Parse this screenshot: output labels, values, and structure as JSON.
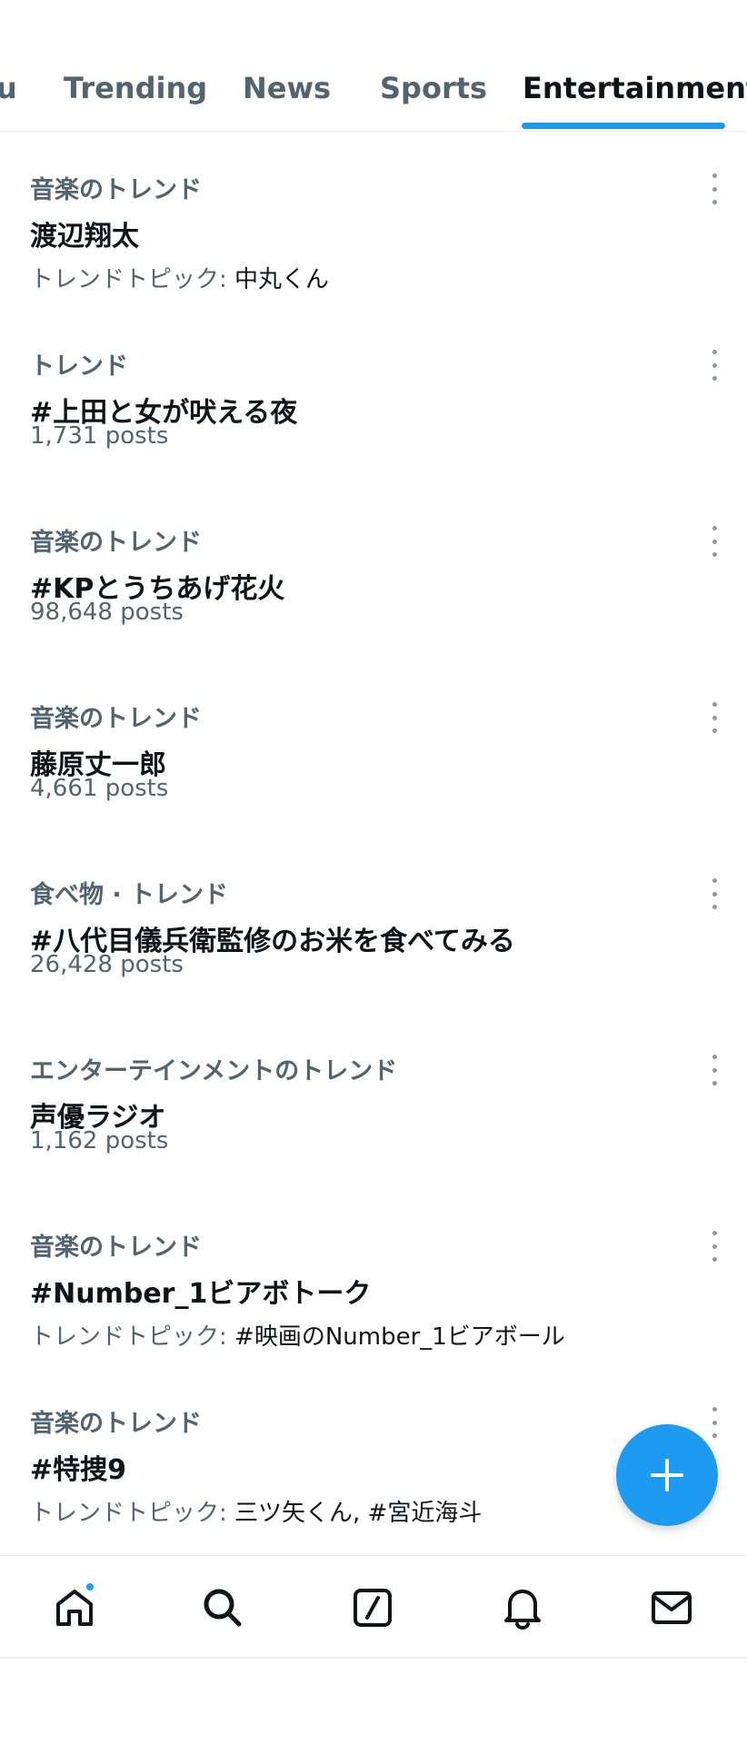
{
  "tabs": [
    {
      "label": "u"
    },
    {
      "label": "Trending"
    },
    {
      "label": "News"
    },
    {
      "label": "Sports"
    },
    {
      "label": "Entertainment",
      "active": true
    }
  ],
  "trends": [
    {
      "category": "音楽のトレンド",
      "title": "渡辺翔太",
      "topic_prefix": "トレンドトピック: ",
      "topic_value": "中丸くん",
      "posts": ""
    },
    {
      "category": "トレンド",
      "title": "#上田と女が吠える夜",
      "topic_prefix": "",
      "topic_value": "",
      "posts": "1,731 posts"
    },
    {
      "category": "音楽のトレンド",
      "title": "#KPとうちあげ花火",
      "topic_prefix": "",
      "topic_value": "",
      "posts": "98,648 posts"
    },
    {
      "category": "音楽のトレンド",
      "title": "藤原丈一郎",
      "topic_prefix": "",
      "topic_value": "",
      "posts": "4,661 posts"
    },
    {
      "category": "食べ物 · トレンド",
      "title": "#八代目儀兵衛監修のお米を食べてみる",
      "topic_prefix": "",
      "topic_value": "",
      "posts": "26,428 posts"
    },
    {
      "category": "エンターテインメントのトレンド",
      "title": "声優ラジオ",
      "topic_prefix": "",
      "topic_value": "",
      "posts": "1,162 posts"
    },
    {
      "category": "音楽のトレンド",
      "title": "#Number_1ビアボトーク",
      "topic_prefix": "トレンドトピック: ",
      "topic_value": "#映画のNumber_1ビアボール",
      "posts": ""
    },
    {
      "category": "音楽のトレンド",
      "title": "#特捜9",
      "topic_prefix": "トレンドトピック: ",
      "topic_value": "三ツ矢くん, #宮近海斗",
      "posts": ""
    }
  ],
  "fab": {
    "icon": "plus-icon"
  },
  "bottom_nav": {
    "items": [
      {
        "icon": "home-icon",
        "has_notification_dot": true
      },
      {
        "icon": "search-icon"
      },
      {
        "icon": "grok-icon"
      },
      {
        "icon": "bell-icon"
      },
      {
        "icon": "mail-icon"
      }
    ]
  },
  "colors": {
    "accent": "#1d9bf0",
    "text_primary": "#0f1419",
    "text_secondary": "#536471"
  }
}
